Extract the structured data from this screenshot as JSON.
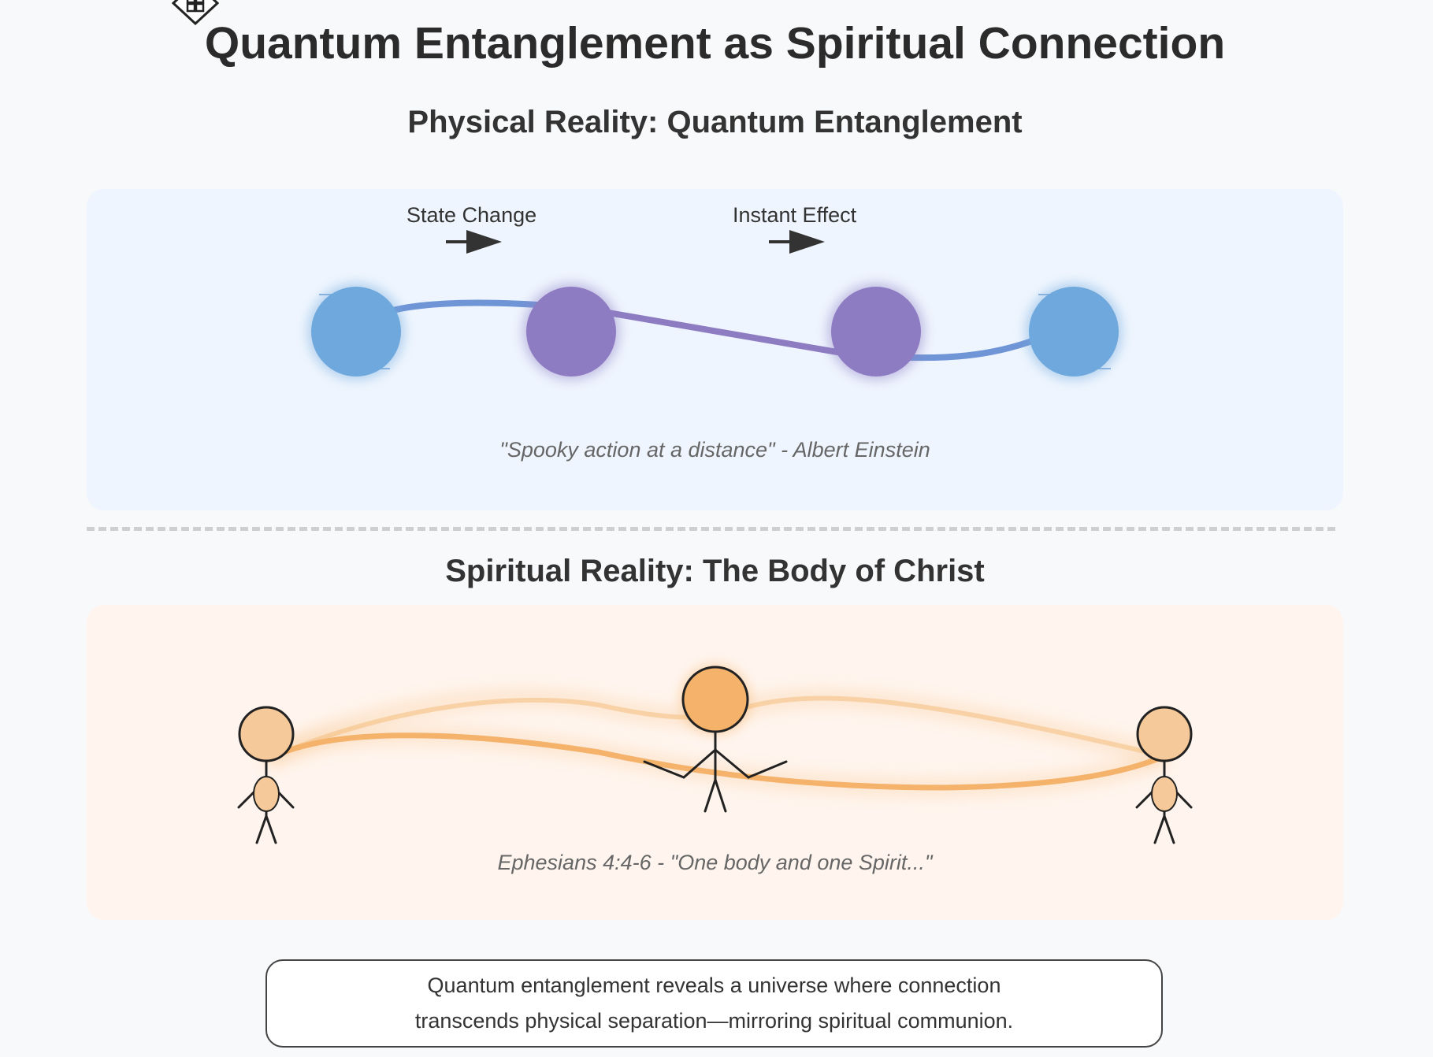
{
  "title": "Quantum Entanglement as Spiritual Connection",
  "physical": {
    "heading": "Physical Reality: Quantum Entanglement",
    "label_state_change": "State Change",
    "label_instant_effect": "Instant Effect",
    "quote": "\"Spooky action at a distance\" - Albert Einstein"
  },
  "spiritual": {
    "heading": "Spiritual Reality: The Body of Christ",
    "quote": "Ephesians 4:4-6 - \"One body and one Spirit...\""
  },
  "conclusion": {
    "line1": "Quantum entanglement reveals a universe where connection",
    "line2": "transcends physical separation—mirroring spiritual communion."
  },
  "colors": {
    "particle_blue": "#6fa8dc",
    "particle_purple": "#8e7cc3",
    "figure_light": "#f6c99a",
    "figure_center": "#f4b26b",
    "connection_orange": "#f4b26b"
  },
  "icons": {
    "corner": "diamond-grid-icon",
    "arrow": "arrow-right-icon"
  }
}
